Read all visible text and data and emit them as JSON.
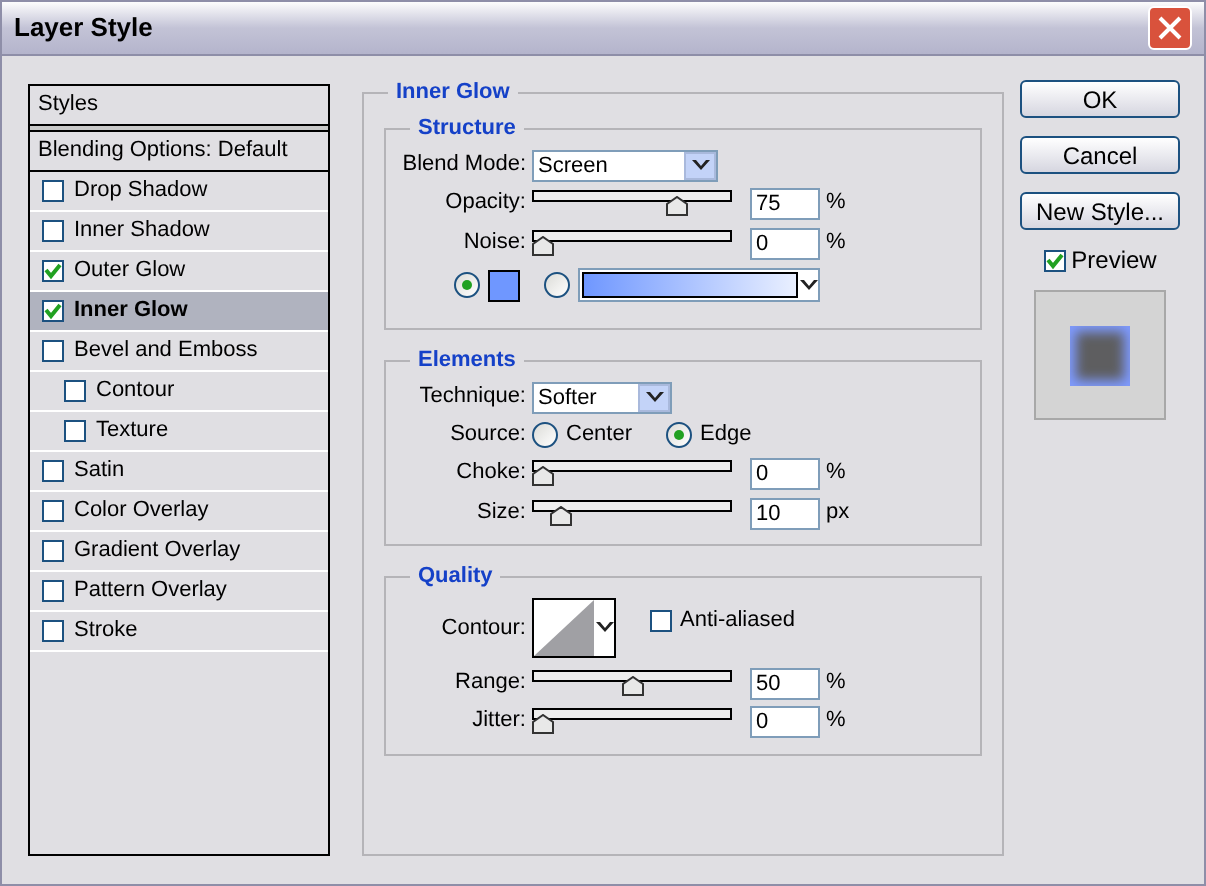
{
  "window": {
    "title": "Layer Style"
  },
  "styles_panel": {
    "header": "Styles",
    "blending_options": {
      "label": "Blending Options: Default",
      "selected": false
    },
    "items": [
      {
        "label": "Drop Shadow",
        "checked": false,
        "selected": false
      },
      {
        "label": "Inner Shadow",
        "checked": false,
        "selected": false
      },
      {
        "label": "Outer Glow",
        "checked": true,
        "selected": false
      },
      {
        "label": "Inner Glow",
        "checked": true,
        "selected": true
      },
      {
        "label": "Bevel and Emboss",
        "checked": false,
        "selected": false,
        "children": [
          {
            "label": "Contour",
            "checked": false,
            "selected": false
          },
          {
            "label": "Texture",
            "checked": false,
            "selected": false
          }
        ]
      },
      {
        "label": "Satin",
        "checked": false,
        "selected": false
      },
      {
        "label": "Color Overlay",
        "checked": false,
        "selected": false
      },
      {
        "label": "Gradient Overlay",
        "checked": false,
        "selected": false
      },
      {
        "label": "Pattern Overlay",
        "checked": false,
        "selected": false
      },
      {
        "label": "Stroke",
        "checked": false,
        "selected": false
      }
    ]
  },
  "inner_glow": {
    "title": "Inner Glow",
    "structure": {
      "title": "Structure",
      "blend_mode": {
        "label": "Blend Mode:",
        "value": "Screen"
      },
      "sliders": [
        {
          "label": "Opacity:",
          "level": 0.75,
          "value": "75",
          "unit": "%"
        },
        {
          "label": "Noise:",
          "level": 0,
          "value": "0",
          "unit": "%"
        }
      ],
      "fill_options": [
        {
          "kind": "color",
          "selected": true
        },
        {
          "kind": "gradient",
          "selected": false
        }
      ]
    },
    "elements": {
      "title": "Elements",
      "technique": {
        "label": "Technique:",
        "value": "Softer"
      },
      "source": {
        "label": "Source:",
        "options": [
          {
            "label": "Center",
            "selected": false
          },
          {
            "label": "Edge",
            "selected": true
          }
        ]
      },
      "sliders": [
        {
          "label": "Choke:",
          "level": 0,
          "value": "0",
          "unit": "%"
        },
        {
          "label": "Size:",
          "level": 0.1,
          "value": "10",
          "unit": "px"
        }
      ]
    },
    "quality": {
      "title": "Quality",
      "contour_label": "Contour:",
      "anti_aliased": {
        "label": "Anti-aliased",
        "checked": false
      },
      "sliders": [
        {
          "label": "Range:",
          "level": 0.5,
          "value": "50",
          "unit": "%"
        },
        {
          "label": "Jitter:",
          "level": 0,
          "value": "0",
          "unit": "%"
        }
      ]
    }
  },
  "buttons": [
    "OK",
    "Cancel",
    "New Style..."
  ],
  "preview": {
    "label": "Preview",
    "checked": true
  }
}
